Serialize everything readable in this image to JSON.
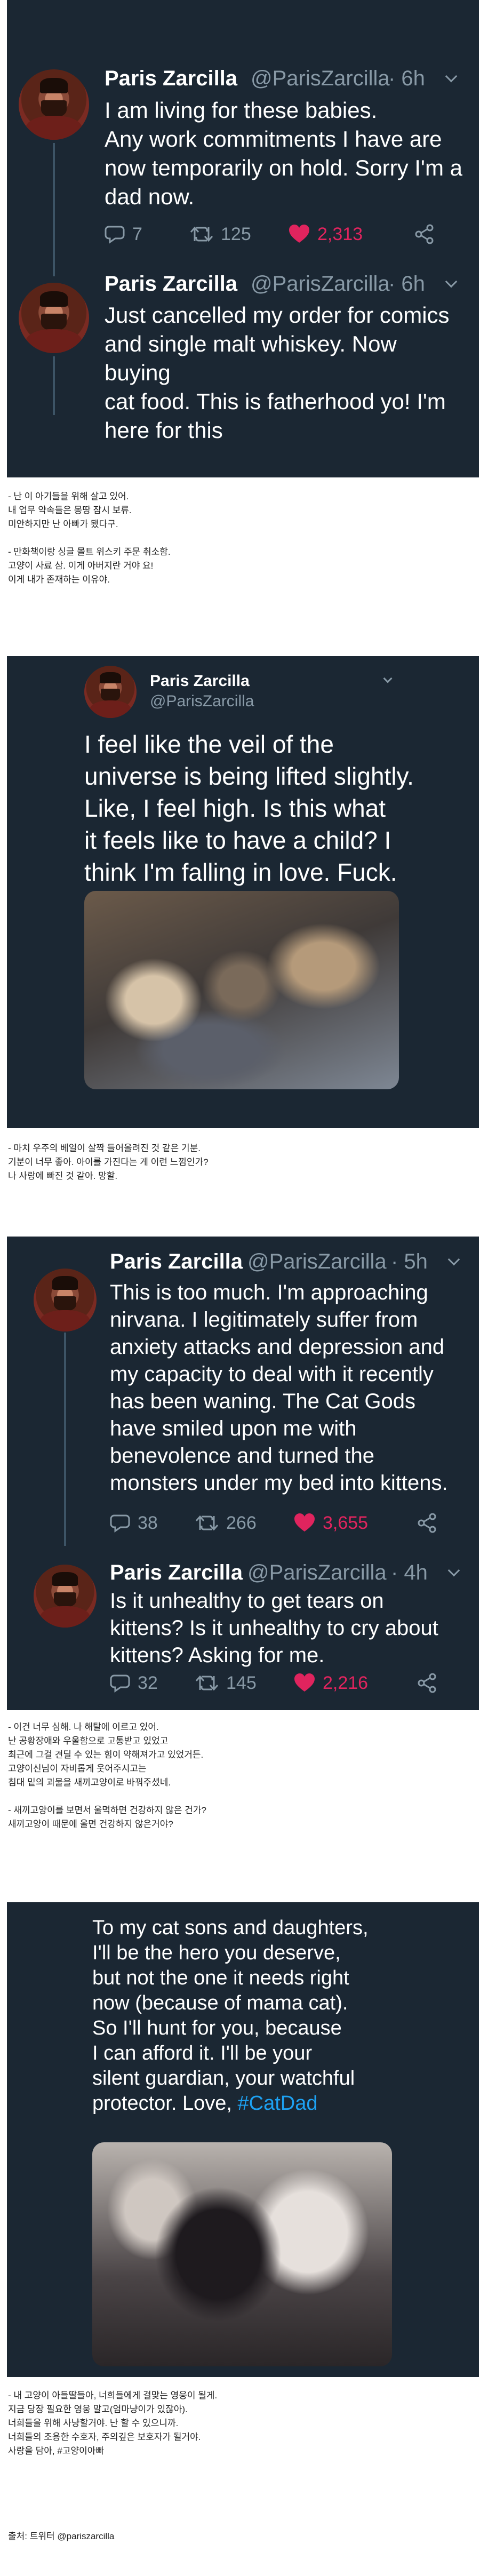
{
  "author": {
    "name": "Paris Zarcilla",
    "handle": "@ParisZarcilla"
  },
  "block1": {
    "tweets": [
      {
        "time": "· 6h",
        "text": "I am living for these babies.\nAny work commitments I have are\nnow temporarily on hold. Sorry I'm a\ndad now.",
        "replies": "7",
        "retweets": "125",
        "likes": "2,313"
      },
      {
        "time": "· 6h",
        "text": "Just cancelled my order for comics\nand single malt whiskey. Now buying\ncat food. This is fatherhood yo! I'm\nhere for this"
      }
    ]
  },
  "caption1": "- 난 이 아기들을 위해 살고 있어.\n내 업무 약속들은 몽땅 잠시 보류.\n미안하지만 난 아빠가 됐다구.\n\n- 만화책이랑 싱글 몰트 위스키 주문 취소함.\n고양이 사료 삼. 이게 아버지란 거야 요!\n이게 내가 존재하는 이유야.",
  "block2": {
    "text": "I feel like the veil of the\nuniverse is being lifted slightly.\nLike, I feel high. Is this what\nit feels like to have a child? I\nthink I'm falling in love. Fuck.",
    "photo_alt": "kittens sleeping together"
  },
  "caption2": "- 마치 우주의 베일이 살짝 들어올려진 것 같은 기분.\n기분이 너무 좋아. 아이를 가진다는 게 이런 느낌인가?\n나 사랑에 빠진 것 같아. 망할.",
  "block3": {
    "tweets": [
      {
        "time": "· 5h",
        "text": "This is too much. I'm approaching\nnirvana. I legitimately suffer from\nanxiety attacks and depression and\nmy capacity to deal with it recently\nhas been waning. The Cat Gods\nhave smiled upon me with\nbenevolence and turned the\nmonsters under my bed into kittens.",
        "replies": "38",
        "retweets": "266",
        "likes": "3,655"
      },
      {
        "time": "· 4h",
        "text": "Is it unhealthy to get tears on\nkittens? Is it unhealthy to cry about\nkittens? Asking for me.",
        "replies": "32",
        "retweets": "145",
        "likes": "2,216"
      }
    ]
  },
  "caption3": "- 이건 너무 심해. 나 해탈에 이르고 있어.\n난 공황장애와 우울함으로 고통받고 있었고\n최근에 그걸 견딜 수 있는 힘이 약해져가고 있었거든.\n고양이신님이 자비롭게 웃어주시고는\n침대 밑의 괴물을 새끼고양이로 바꿔주셨네.\n\n- 새끼고양이를 보면서 울먹하면 건강하지 않은 건가?\n새끼고양이 때문에 울면 건강하지 않은거야?",
  "block4": {
    "text": "To my cat sons and daughters,\nI'll be the hero you deserve,\nbut not the one it needs right\nnow (because of mama cat).\nSo I'll hunt for you, because\nI can afford it. I'll be your\nsilent guardian, your watchful\nprotector. Love, ",
    "hashtag": "#CatDad",
    "photo_alt": "newborn kittens"
  },
  "caption4": "- 내 고양이 아들딸들아, 너희들에게 걸맞는 영웅이 될게.\n지금 당장 필요한 영웅 말고(엄마냥이가 있잖아).\n너희들을 위해 사냥할거야. 난 할 수 있으니까.\n너희들의 조용한 수호자, 주의깊은 보호자가 될거야.\n사랑을 담아, #고양이아빠",
  "source": "출처: 트위터 @pariszarcilla",
  "colors": {
    "background": "#1b2733",
    "like": "#e0245e",
    "hashtag": "#1da1f2",
    "muted": "#8899a6"
  }
}
